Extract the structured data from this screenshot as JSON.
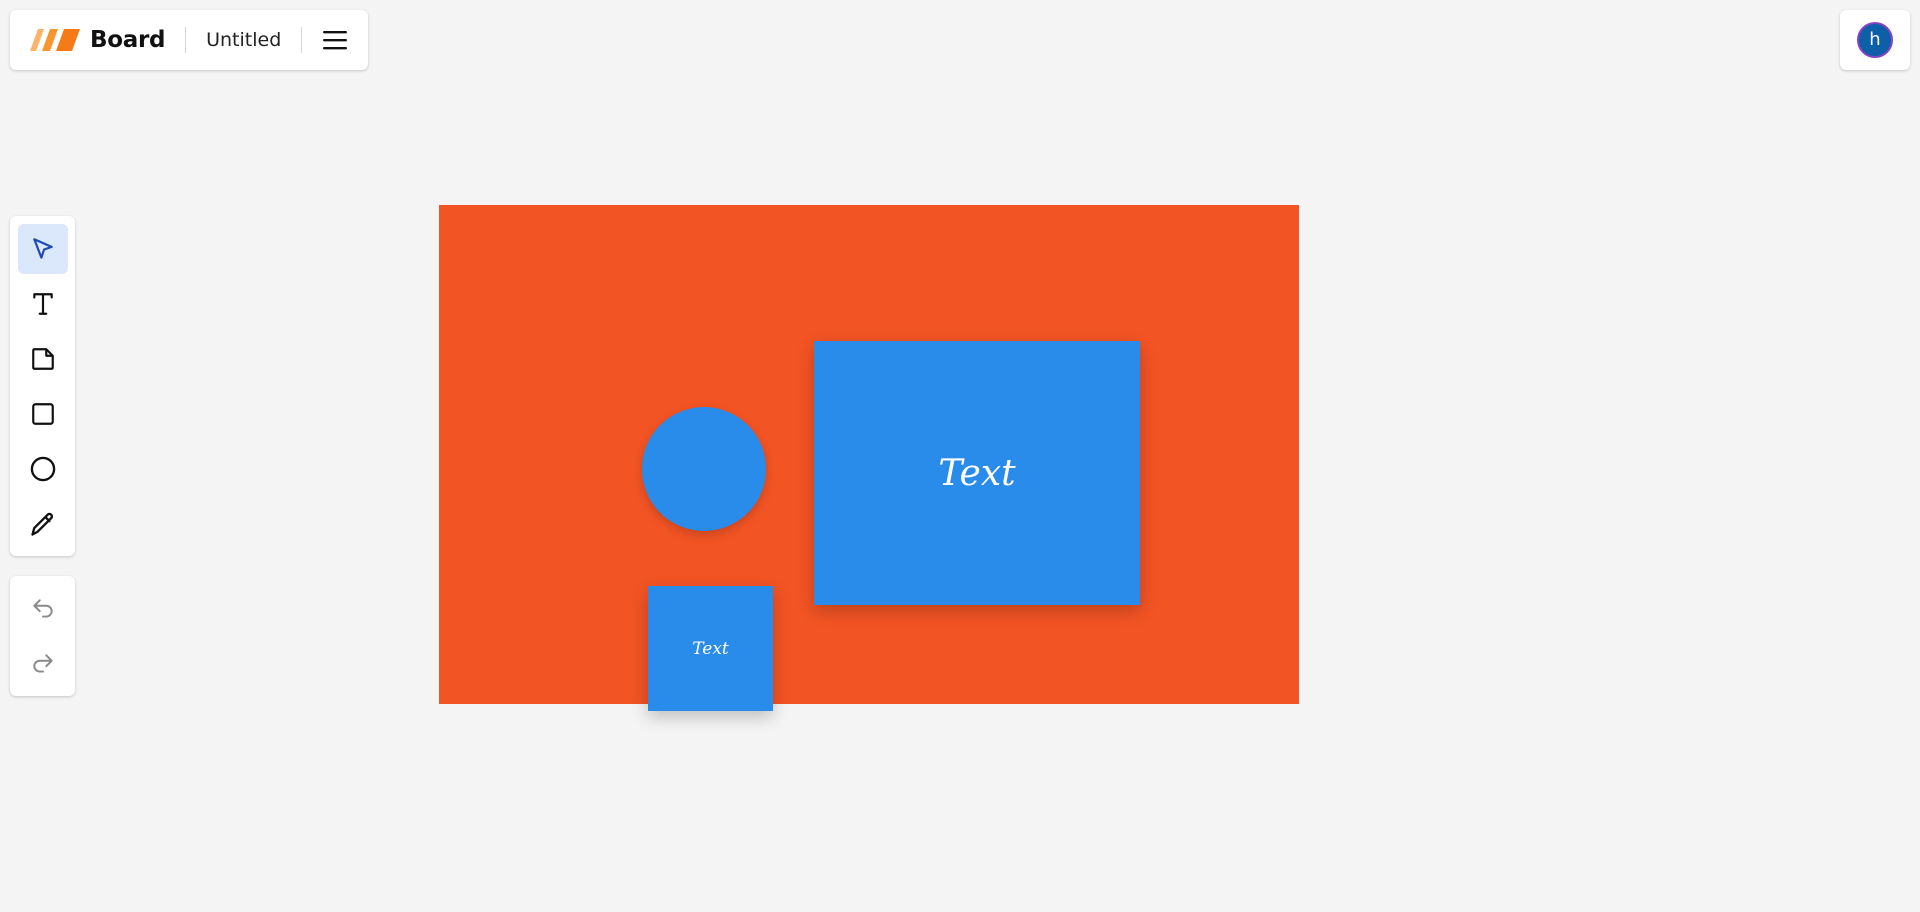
{
  "header": {
    "brand": "Board",
    "doc_title": "Untitled",
    "logo_icon": "board-logo-icon",
    "menu_icon": "hamburger-menu-icon"
  },
  "user": {
    "avatar_initial": "h"
  },
  "toolbar": {
    "tools": [
      {
        "id": "select",
        "icon": "cursor-arrow-icon",
        "active": true
      },
      {
        "id": "text",
        "icon": "text-tool-icon",
        "active": false
      },
      {
        "id": "sticky-note",
        "icon": "sticky-note-icon",
        "active": false
      },
      {
        "id": "rectangle",
        "icon": "square-icon",
        "active": false
      },
      {
        "id": "ellipse",
        "icon": "circle-icon",
        "active": false
      },
      {
        "id": "pen",
        "icon": "pencil-icon",
        "active": false
      }
    ],
    "history": [
      {
        "id": "undo",
        "icon": "undo-icon"
      },
      {
        "id": "redo",
        "icon": "redo-icon"
      }
    ]
  },
  "canvas": {
    "frame_color": "#f35424",
    "shape_color": "#2a8cea",
    "shapes": [
      {
        "type": "circle",
        "text": ""
      },
      {
        "type": "rectangle",
        "text": "Text"
      },
      {
        "type": "rectangle",
        "text": "Text"
      }
    ]
  },
  "colors": {
    "accent": "#2a8cea",
    "active_tool_bg": "#dbe7fb",
    "logo_orange": "#f58220"
  }
}
